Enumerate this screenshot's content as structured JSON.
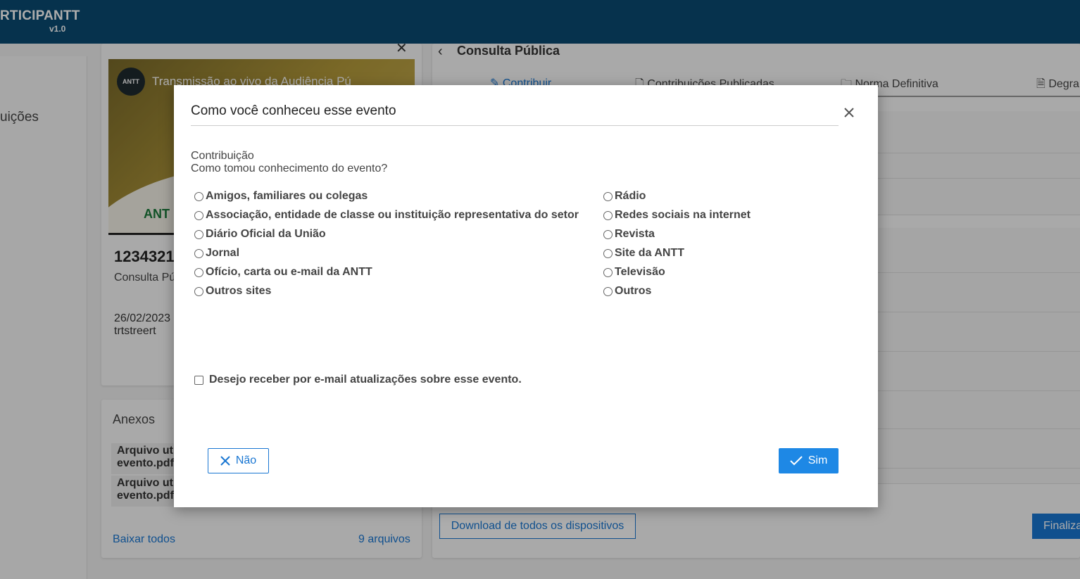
{
  "app": {
    "brand": "RTICIPANTT",
    "version": "v1.0"
  },
  "sidebar": {
    "item_label": "uições"
  },
  "event": {
    "video_title": "Transmissão ao vivo da Audiência Pú",
    "video_logo": "ANTT",
    "video_watermark": "ANT",
    "id": "1234321",
    "type": "Consulta Pú",
    "date": "26/02/2023",
    "name": "trtstreert"
  },
  "anexos": {
    "title": "Anexos",
    "items": [
      {
        "line1": "Arquivo uti",
        "line2": "evento.pdf"
      },
      {
        "line1": "Arquivo uti",
        "line2": "evento.pdf"
      }
    ],
    "download_all": "Baixar todos",
    "count": "9 arquivos"
  },
  "main": {
    "title": "Consulta Pública",
    "tabs": [
      {
        "label": "Contribuir",
        "icon": "pencil-icon",
        "active": true
      },
      {
        "label": "Contribuições Publicadas",
        "icon": "document-icon",
        "active": false
      },
      {
        "label": "Norma Definitiva",
        "icon": "folder-icon",
        "active": false
      },
      {
        "label": "Degra",
        "icon": "pdf-icon",
        "active": false
      }
    ],
    "download_button": "Download de todos os dispositivos",
    "finalize_button": "Finaliza"
  },
  "modal": {
    "title": "Como você conheceu esse evento",
    "category": "Contribuição",
    "question": "Como tomou conhecimento do evento?",
    "options_left": [
      "Amigos, familiares ou colegas",
      "Associação, entidade de classe ou instituição representativa do setor",
      "Diário Oficial da União",
      "Jornal",
      "Ofício, carta ou e-mail da ANTT",
      "Outros sites"
    ],
    "options_right": [
      "Rádio",
      "Redes sociais na internet",
      "Revista",
      "Site da ANTT",
      "Televisão",
      "Outros"
    ],
    "email_checkbox": "Desejo receber por e-mail atualizações sobre esse evento.",
    "no_button": "Não",
    "yes_button": "Sim",
    "colors": {
      "primary": "#1e88e5",
      "topbar": "#0a4a72"
    }
  }
}
